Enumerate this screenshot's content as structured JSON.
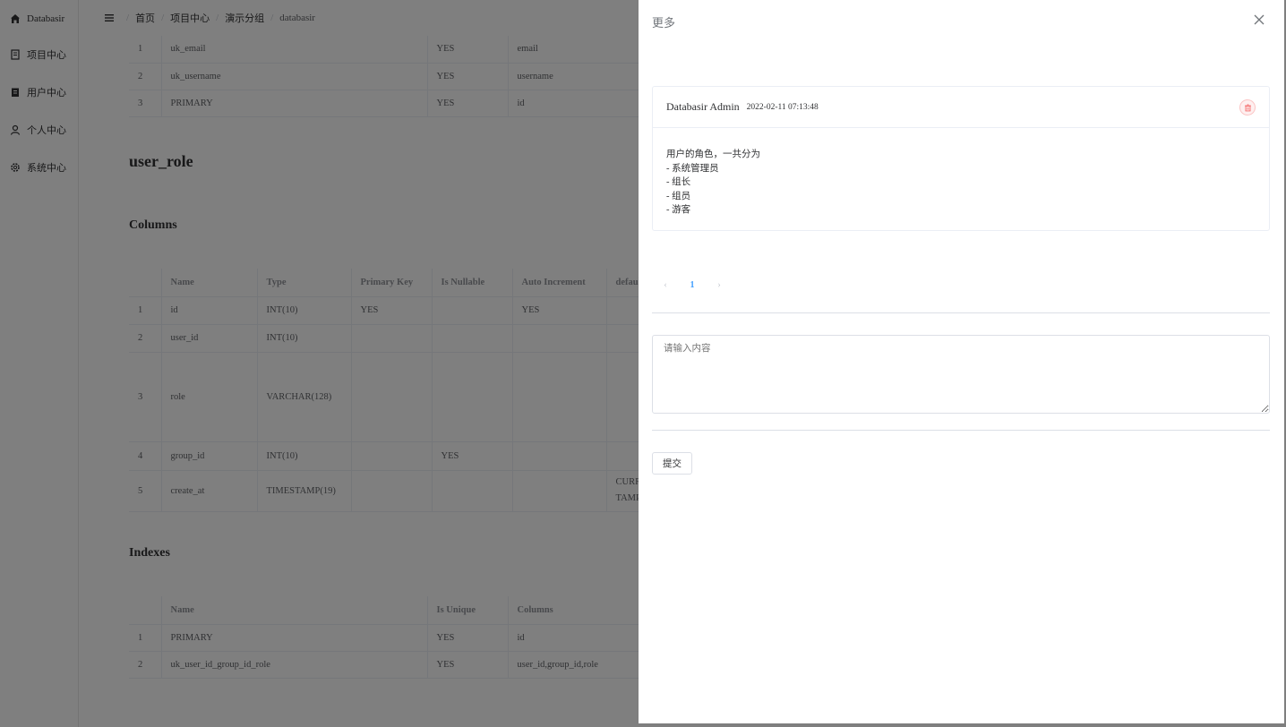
{
  "app": {
    "brand": "Databasir",
    "sidebar": [
      {
        "label": "项目中心",
        "icon": "notebook-icon"
      },
      {
        "label": "用户中心",
        "icon": "clipboard-icon"
      },
      {
        "label": "个人中心",
        "icon": "user-icon"
      },
      {
        "label": "系统中心",
        "icon": "gear-icon"
      }
    ],
    "breadcrumb": [
      "首页",
      "项目中心",
      "演示分组",
      "databasir"
    ]
  },
  "content": {
    "prev_index_rows": [
      {
        "no": "1",
        "name": "uk_email",
        "unique": "YES",
        "columns": "email"
      },
      {
        "no": "2",
        "name": "uk_username",
        "unique": "YES",
        "columns": "username"
      },
      {
        "no": "3",
        "name": "PRIMARY",
        "unique": "YES",
        "columns": "id"
      }
    ],
    "table_name": "user_role",
    "columns_title": "Columns",
    "columns_headers": [
      "",
      "Name",
      "Type",
      "Primary Key",
      "Is Nullable",
      "Auto Increment",
      "default"
    ],
    "columns_rows": [
      {
        "no": "1",
        "name": "id",
        "type": "INT(10)",
        "pk": "YES",
        "nullable": "",
        "auto": "YES",
        "default": ""
      },
      {
        "no": "2",
        "name": "user_id",
        "type": "INT(10)",
        "pk": "",
        "nullable": "",
        "auto": "",
        "default": ""
      },
      {
        "no": "3",
        "name": "role",
        "type": "VARCHAR(128)",
        "pk": "",
        "nullable": "",
        "auto": "",
        "default": ""
      },
      {
        "no": "4",
        "name": "group_id",
        "type": "INT(10)",
        "pk": "",
        "nullable": "YES",
        "auto": "",
        "default": ""
      },
      {
        "no": "5",
        "name": "create_at",
        "type": "TIMESTAMP(19)",
        "pk": "",
        "nullable": "",
        "auto": "",
        "default": "CURR TAMP"
      }
    ],
    "indexes_title": "Indexes",
    "indexes_headers": [
      "",
      "Name",
      "Is Unique",
      "Columns"
    ],
    "indexes_rows": [
      {
        "no": "1",
        "name": "PRIMARY",
        "unique": "YES",
        "columns": "id"
      },
      {
        "no": "2",
        "name": "uk_user_id_group_id_role",
        "unique": "YES",
        "columns": "user_id,group_id,role"
      }
    ]
  },
  "drawer": {
    "title": "更多",
    "comment": {
      "author": "Databasir Admin",
      "time": "2022-02-11 07:13:48",
      "lines": [
        "用户的角色，一共分为",
        "- 系统管理员",
        "- 组长",
        "- 组员",
        "- 游客"
      ]
    },
    "pagination": {
      "current": "1",
      "prev_symbol": "‹",
      "next_symbol": "›"
    },
    "textarea_placeholder": "请输入内容",
    "submit_label": "提交"
  },
  "colors": {
    "accent": "#409eff",
    "danger": "#f56c6c",
    "overlay": "rgba(0,0,0,0.5)"
  }
}
